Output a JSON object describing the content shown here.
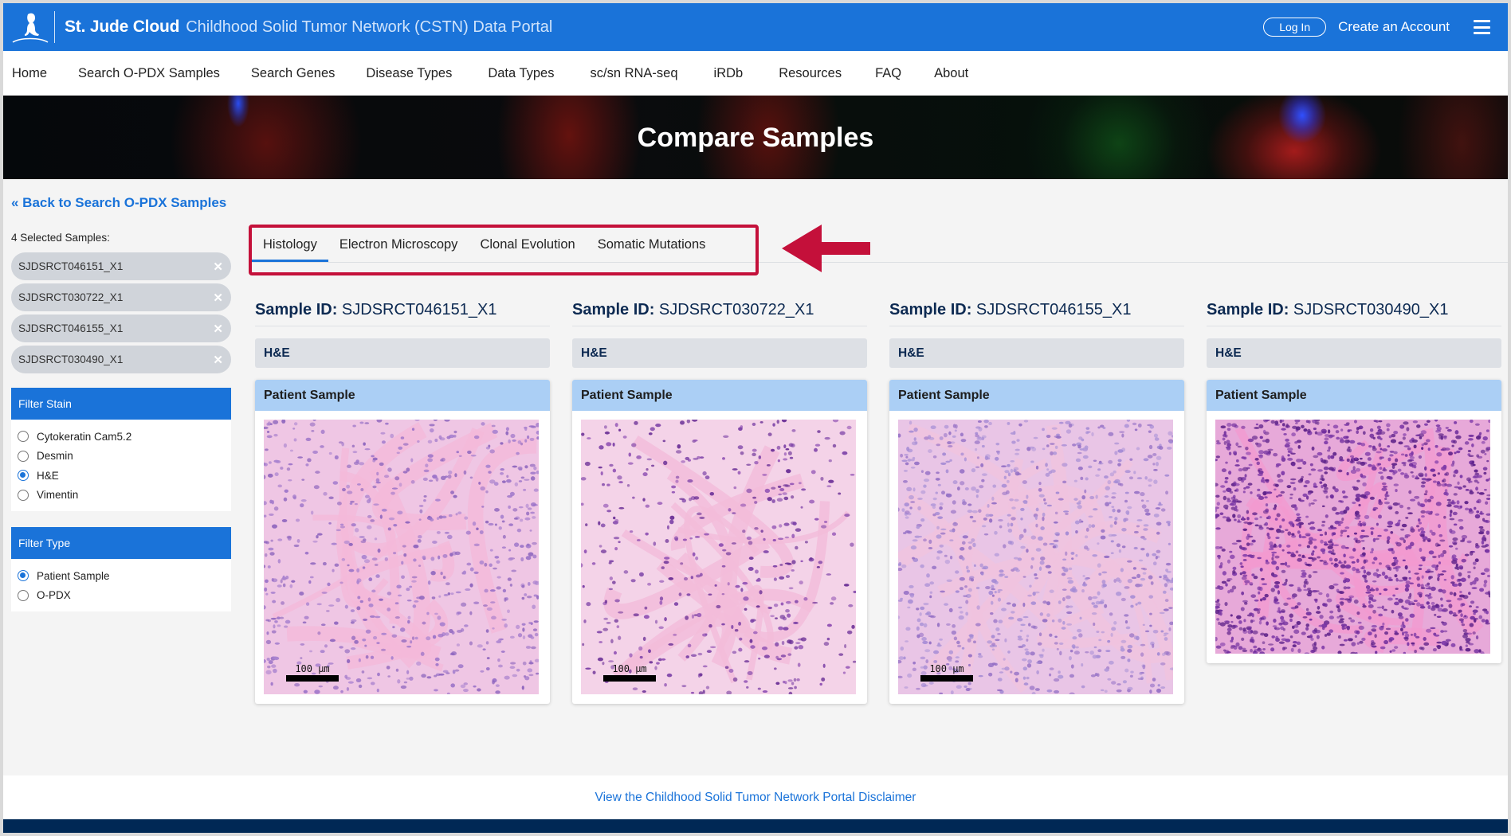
{
  "header": {
    "brand": "St. Jude Cloud",
    "portal_title": "Childhood Solid Tumor Network (CSTN) Data Portal",
    "login_label": "Log In",
    "create_account_label": "Create an Account",
    "logo_icon": "st-jude-child-statue-logo",
    "menu_icon": "hamburger-icon",
    "colors": {
      "primary": "#1a73d9",
      "navy": "#002855"
    }
  },
  "nav": {
    "items": [
      {
        "label": "Home"
      },
      {
        "label": "Search O-PDX Samples"
      },
      {
        "label": "Search Genes"
      },
      {
        "label": "Disease Types"
      },
      {
        "label": "Data Types"
      },
      {
        "label": "sc/sn RNA-seq"
      },
      {
        "label": "iRDb"
      },
      {
        "label": "Resources"
      },
      {
        "label": "FAQ"
      },
      {
        "label": "About"
      }
    ]
  },
  "hero": {
    "title": "Compare Samples"
  },
  "sidebar": {
    "back_link": "« Back to Search O-PDX Samples",
    "selected_label": "4 Selected Samples:",
    "selected_samples": [
      {
        "label": "SJDSRCT046151_X1",
        "remove_icon": "close-icon"
      },
      {
        "label": "SJDSRCT030722_X1",
        "remove_icon": "close-icon"
      },
      {
        "label": "SJDSRCT046155_X1",
        "remove_icon": "close-icon"
      },
      {
        "label": "SJDSRCT030490_X1",
        "remove_icon": "close-icon"
      }
    ],
    "filter_stain": {
      "title": "Filter Stain",
      "options": [
        {
          "label": "Cytokeratin Cam5.2",
          "checked": false
        },
        {
          "label": "Desmin",
          "checked": false
        },
        {
          "label": "H&E",
          "checked": true
        },
        {
          "label": "Vimentin",
          "checked": false
        }
      ]
    },
    "filter_type": {
      "title": "Filter Type",
      "options": [
        {
          "label": "Patient Sample",
          "checked": true
        },
        {
          "label": "O-PDX",
          "checked": false
        }
      ]
    }
  },
  "tabs": {
    "items": [
      {
        "label": "Histology",
        "active": true
      },
      {
        "label": "Electron Microscopy",
        "active": false
      },
      {
        "label": "Clonal Evolution",
        "active": false
      },
      {
        "label": "Somatic Mutations",
        "active": false
      }
    ],
    "annotation": {
      "type": "highlight-box-with-arrow",
      "color": "#c4103a"
    }
  },
  "samples": [
    {
      "id_label": "Sample ID:",
      "id": "SJDSRCT046151_X1",
      "stain": "H&E",
      "type": "Patient Sample",
      "image": "H&E histology micrograph",
      "scale_bar": "100 µm"
    },
    {
      "id_label": "Sample ID:",
      "id": "SJDSRCT030722_X1",
      "stain": "H&E",
      "type": "Patient Sample",
      "image": "H&E histology micrograph",
      "scale_bar": "100 µm"
    },
    {
      "id_label": "Sample ID:",
      "id": "SJDSRCT046155_X1",
      "stain": "H&E",
      "type": "Patient Sample",
      "image": "H&E histology micrograph",
      "scale_bar": "100 µm"
    },
    {
      "id_label": "Sample ID:",
      "id": "SJDSRCT030490_X1",
      "stain": "H&E",
      "type": "Patient Sample",
      "image": "H&E histology micrograph",
      "scale_bar": ""
    }
  ],
  "footer": {
    "disclaimer_link": "View the Childhood Solid Tumor Network Portal Disclaimer"
  }
}
